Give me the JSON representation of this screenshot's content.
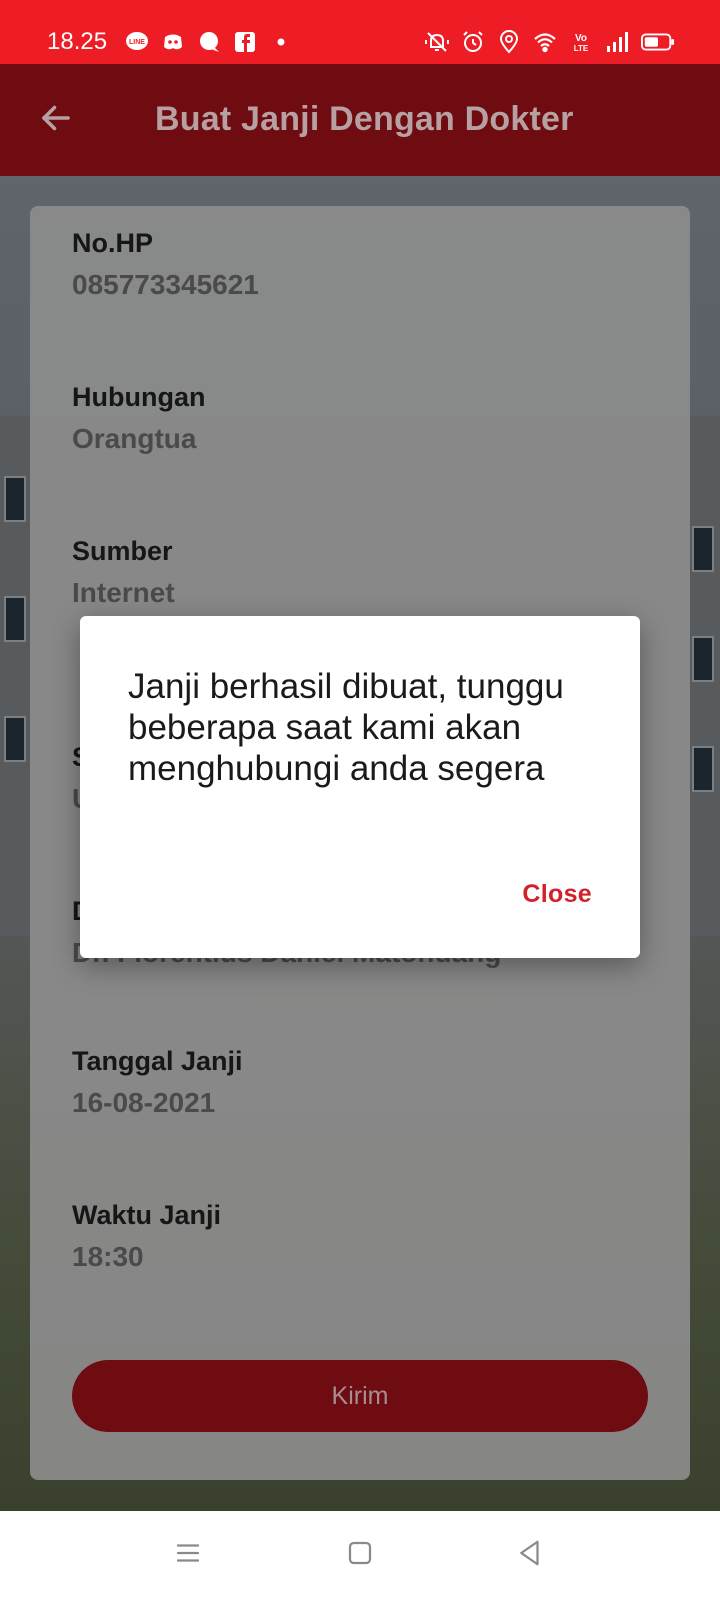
{
  "status_bar": {
    "time": "18.25",
    "left_icons": [
      "line-icon",
      "discord-icon",
      "chat-bubble-icon",
      "facebook-icon",
      "dot-icon"
    ],
    "right_icons": [
      "vibrate-icon",
      "alarm-icon",
      "location-icon",
      "wifi-icon",
      "volte-icon",
      "signal-icon",
      "battery-icon"
    ],
    "color": "#ee1c24"
  },
  "app_bar": {
    "title": "Buat Janji Dengan Dokter",
    "color": "#6e0c12"
  },
  "form": {
    "fields": [
      {
        "label": "No.HP",
        "value": "085773345621"
      },
      {
        "label": "Hubungan",
        "value": "Orangtua"
      },
      {
        "label": "Sumber",
        "value": "Internet"
      },
      {
        "label": "S",
        "value": "U"
      },
      {
        "label": "D",
        "value": "Dr. Florentius Daniel Matondang"
      },
      {
        "label": "Tanggal Janji",
        "value": "16-08-2021"
      },
      {
        "label": "Waktu Janji",
        "value": "18:30"
      }
    ],
    "submit_label": "Kirim"
  },
  "dialog": {
    "message": "Janji berhasil dibuat, tunggu beberapa saat kami akan menghubungi anda segera",
    "close_label": "Close",
    "accent": "#d4202a"
  },
  "nav_bar": {
    "icons": [
      "menu-icon",
      "home-square-icon",
      "back-triangle-icon"
    ]
  }
}
